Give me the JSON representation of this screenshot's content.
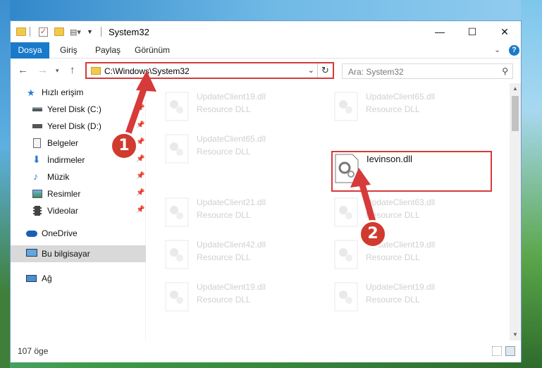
{
  "window": {
    "title": "System32"
  },
  "ribbon": {
    "tabs": [
      "Dosya",
      "Giriş",
      "Paylaş",
      "Görünüm"
    ]
  },
  "nav": {
    "address": "C:\\Windows\\System32",
    "search_placeholder": "Ara: System32"
  },
  "sidebar": {
    "items": [
      {
        "label": "Hızlı erişim",
        "icon": "star-icon"
      },
      {
        "label": "Yerel Disk (C:)",
        "icon": "drive-icon"
      },
      {
        "label": "Yerel Disk (D:)",
        "icon": "drive-icon"
      },
      {
        "label": "Belgeler",
        "icon": "documents-icon"
      },
      {
        "label": "İndirmeler",
        "icon": "download-icon"
      },
      {
        "label": "Müzik",
        "icon": "music-icon"
      },
      {
        "label": "Resimler",
        "icon": "pictures-icon"
      },
      {
        "label": "Videolar",
        "icon": "videos-icon"
      },
      {
        "label": "OneDrive",
        "icon": "cloud-icon"
      },
      {
        "label": "Bu bilgisayar",
        "icon": "computer-icon"
      },
      {
        "label": "Ağ",
        "icon": "network-icon"
      }
    ]
  },
  "files": [
    {
      "name": "UpdateClient19.dll",
      "type": "Resource DLL"
    },
    {
      "name": "UpdateClient65.dll",
      "type": "Resource DLL"
    },
    {
      "name": "UpdateClient65.dll",
      "type": "Resource DLL"
    },
    {
      "name": "Ievinson.dll",
      "type": ""
    },
    {
      "name": "UpdateClient21.dll",
      "type": "Resource DLL"
    },
    {
      "name": "UpdateClient63.dll",
      "type": "Resource DLL"
    },
    {
      "name": "UpdateClient42.dll",
      "type": "Resource DLL"
    },
    {
      "name": "UpdateClient19.dll",
      "type": "Resource DLL"
    },
    {
      "name": "UpdateClient19.dll",
      "type": "Resource DLL"
    },
    {
      "name": "UpdateClient19.dll",
      "type": "Resource DLL"
    }
  ],
  "status": {
    "item_count": "107 öge"
  },
  "annotations": {
    "step1": "1",
    "step2": "2",
    "color": "#d63a3a"
  }
}
